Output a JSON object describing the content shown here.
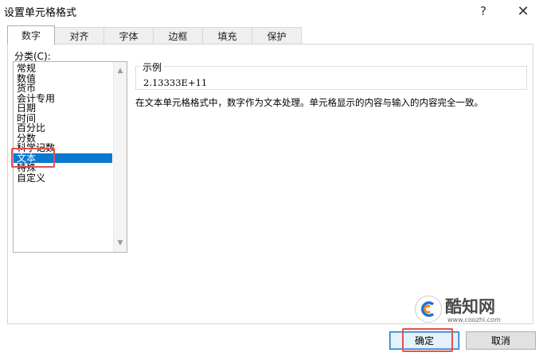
{
  "window": {
    "title": "设置单元格格式",
    "help_label": "?",
    "close_label": "✕"
  },
  "tabs": [
    {
      "label": "数字",
      "active": true
    },
    {
      "label": "对齐",
      "active": false
    },
    {
      "label": "字体",
      "active": false
    },
    {
      "label": "边框",
      "active": false
    },
    {
      "label": "填充",
      "active": false
    },
    {
      "label": "保护",
      "active": false
    }
  ],
  "category": {
    "label": "分类(C):",
    "items": [
      "常规",
      "数值",
      "货币",
      "会计专用",
      "日期",
      "时间",
      "百分比",
      "分数",
      "科学记数",
      "文本",
      "特殊",
      "自定义"
    ],
    "selected": "文本"
  },
  "sample": {
    "label": "示例",
    "value": "2.13333E+11"
  },
  "description": "在文本单元格格式中，数字作为文本处理。单元格显示的内容与输入的内容完全一致。",
  "buttons": {
    "ok": "确定",
    "cancel": "取消"
  },
  "watermark": {
    "name": "酷知网",
    "url": "www.coozhi.com"
  },
  "colors": {
    "selection": "#0b79d0",
    "annotation": "#e05252"
  }
}
